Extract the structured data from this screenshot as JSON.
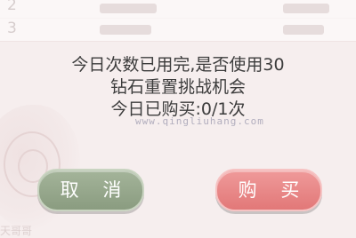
{
  "background": {
    "rows": [
      {
        "rank": "2"
      },
      {
        "rank": "3"
      }
    ],
    "bottom_text": "天哥哥"
  },
  "dialog": {
    "message_lines": [
      "今日次数已用完,是否使用30",
      "钻石重置挑战机会",
      "今日已购买:0/1次"
    ],
    "watermark": "www.qingliuhang.com",
    "cancel_label": "取 消",
    "buy_label": "购 买"
  },
  "colors": {
    "cancel_button": "#97a88d",
    "buy_button": "#e88585",
    "message_text": "#3c3c3c"
  }
}
